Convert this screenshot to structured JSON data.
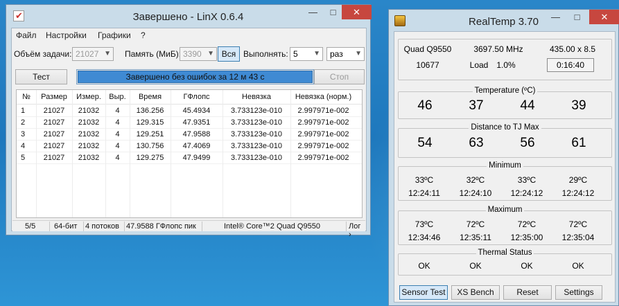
{
  "linx": {
    "title": "Завершено - LinX 0.6.4",
    "menu": [
      "Файл",
      "Настройки",
      "Графики",
      "?"
    ],
    "problem_size_label": "Объём задачи:",
    "problem_size_value": "21027",
    "memory_label": "Память (МиБ):",
    "memory_value": "3390",
    "all_button": "Вся",
    "run_label": "Выполнять:",
    "run_value": "5",
    "run_unit": "раз",
    "test_button": "Тест",
    "progress_text": "Завершено без ошибок за 12 м 43 с",
    "progress_value": 1.0,
    "stop_button": "Стоп",
    "columns": [
      "№",
      "Размер",
      "Измер.",
      "Выр.",
      "Время",
      "ГФлопс",
      "Невязка",
      "Невязка (норм.)"
    ],
    "rows": [
      [
        "1",
        "21027",
        "21032",
        "4",
        "136.256",
        "45.4934",
        "3.733123e-010",
        "2.997971e-002"
      ],
      [
        "2",
        "21027",
        "21032",
        "4",
        "129.315",
        "47.9351",
        "3.733123e-010",
        "2.997971e-002"
      ],
      [
        "3",
        "21027",
        "21032",
        "4",
        "129.251",
        "47.9588",
        "3.733123e-010",
        "2.997971e-002"
      ],
      [
        "4",
        "21027",
        "21032",
        "4",
        "130.756",
        "47.4069",
        "3.733123e-010",
        "2.997971e-002"
      ],
      [
        "5",
        "21027",
        "21032",
        "4",
        "129.275",
        "47.9499",
        "3.733123e-010",
        "2.997971e-002"
      ]
    ],
    "status": {
      "runs": "5/5",
      "bits": "64-бит",
      "threads": "4 потоков",
      "peak": "47.9588 ГФлопс пик",
      "cpu": "Intel® Core™2 Quad Q9550",
      "log": "Лог ›"
    }
  },
  "realtemp": {
    "title": "RealTemp 3.70",
    "cpu_name": "Quad Q9550",
    "clock": "3697.50 MHz",
    "multiplier": "435.00 x 8.5",
    "vid": "10677",
    "load_label": "Load",
    "load_value": "1.0%",
    "timer": "0:16:40",
    "temperature_caption": "Temperature (ºC)",
    "temperatures": [
      "46",
      "37",
      "44",
      "39"
    ],
    "distance_caption": "Distance to TJ Max",
    "distances": [
      "54",
      "63",
      "56",
      "61"
    ],
    "minimum_caption": "Minimum",
    "minimum_temps": [
      "33ºC",
      "32ºC",
      "33ºC",
      "29ºC"
    ],
    "minimum_times": [
      "12:24:11",
      "12:24:10",
      "12:24:12",
      "12:24:12"
    ],
    "maximum_caption": "Maximum",
    "maximum_temps": [
      "73ºC",
      "72ºC",
      "72ºC",
      "72ºC"
    ],
    "maximum_times": [
      "12:34:46",
      "12:35:11",
      "12:35:00",
      "12:35:04"
    ],
    "thermal_caption": "Thermal Status",
    "thermal_status": [
      "OK",
      "OK",
      "OK",
      "OK"
    ],
    "buttons": [
      "Sensor Test",
      "XS Bench",
      "Reset",
      "Settings"
    ]
  },
  "colors": {
    "desktop": "#2a86c9",
    "titlebar": "#c9dce9",
    "close_button": "#c7473f",
    "progress_fill": "#3f8ad3"
  },
  "icons": [
    "linx-app-icon",
    "realtemp-app-icon",
    "minimize-icon",
    "maximize-icon",
    "close-icon",
    "chevron-down-icon"
  ]
}
